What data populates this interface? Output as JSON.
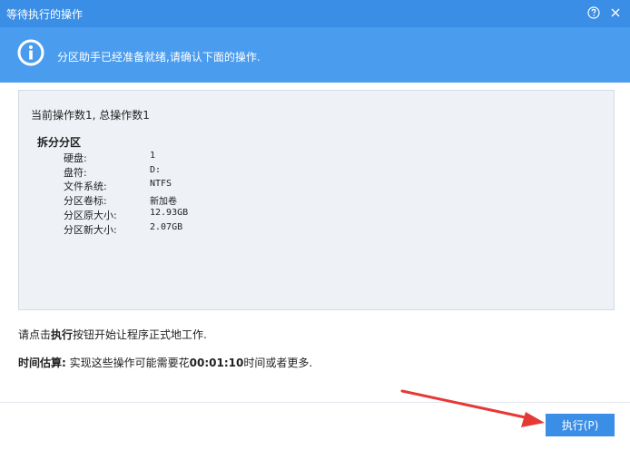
{
  "window": {
    "title": "等待执行的操作",
    "help_icon": "help-icon",
    "close_icon": "close-icon"
  },
  "banner": {
    "icon": "info-icon",
    "message": "分区助手已经准备就绪,请确认下面的操作."
  },
  "operations": {
    "count_text": "当前操作数1, 总操作数1",
    "title": "拆分分区",
    "properties": [
      {
        "label": "硬盘:",
        "value": "1"
      },
      {
        "label": "盘符:",
        "value": "D:"
      },
      {
        "label": "文件系统:",
        "value": "NTFS"
      },
      {
        "label": "分区卷标:",
        "value": "新加卷"
      },
      {
        "label": "分区原大小:",
        "value": "12.93GB"
      },
      {
        "label": "分区新大小:",
        "value": "2.07GB"
      }
    ]
  },
  "hint": {
    "prefix": "请点击",
    "button_ref": "执行",
    "suffix": "按钮开始让程序正式地工作."
  },
  "estimate": {
    "label": "时间估算:",
    "prefix": " 实现这些操作可能需要花",
    "time": "00:01:10",
    "suffix": "时间或者更多."
  },
  "footer": {
    "execute_label": "执行(P)"
  },
  "colors": {
    "titlebar": "#3a8ee6",
    "banner": "#4a9cee",
    "content_bg": "#eef2f7",
    "annotation_arrow": "#e53935"
  }
}
